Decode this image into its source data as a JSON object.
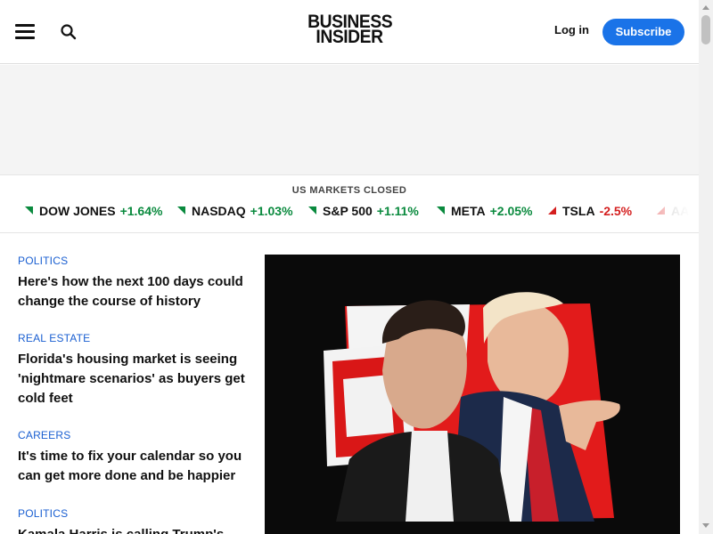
{
  "header": {
    "logo_line1": "BUSINESS",
    "logo_line2": "INSIDER",
    "login_label": "Log in",
    "subscribe_label": "Subscribe",
    "menu_icon": "hamburger-menu-icon",
    "search_icon": "search-icon",
    "accent_color": "#1a73e8"
  },
  "markets": {
    "title": "US MARKETS CLOSED",
    "tickers": [
      {
        "name": "DOW JONES",
        "change": "+1.64%",
        "direction": "up"
      },
      {
        "name": "NASDAQ",
        "change": "+1.03%",
        "direction": "up"
      },
      {
        "name": "S&P 500",
        "change": "+1.11%",
        "direction": "up"
      },
      {
        "name": "META",
        "change": "+2.05%",
        "direction": "up"
      },
      {
        "name": "TSLA",
        "change": "-2.5%",
        "direction": "down"
      },
      {
        "name": "AA",
        "change": "",
        "direction": "down"
      }
    ],
    "up_color": "#0a8a3e",
    "down_color": "#d41f1f"
  },
  "stories": [
    {
      "category": "POLITICS",
      "headline": "Here's how the next 100 days could change the course of history"
    },
    {
      "category": "REAL ESTATE",
      "headline": "Florida's housing market is seeing 'nightmare scenarios' as buyers get cold feet"
    },
    {
      "category": "CAREERS",
      "headline": "It's time to fix your calendar so you can get more done and be happier"
    },
    {
      "category": "POLITICS",
      "headline": "Kamala Harris is calling Trump's"
    }
  ],
  "category_color": "#1a5fd1"
}
